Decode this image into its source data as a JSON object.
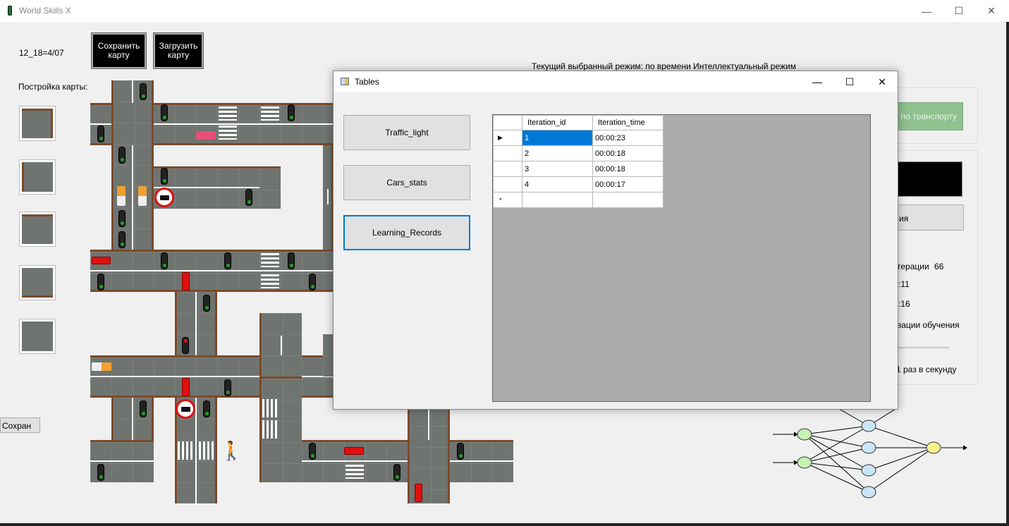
{
  "window": {
    "title": "World Skills X",
    "min": "—",
    "max": "☐",
    "close": "✕"
  },
  "left": {
    "id_label": "12_18=4/07",
    "save_map": "Сохранить карту",
    "load_map": "Загрузить карту",
    "build_label": "Постройка карты:",
    "save_small": "Сохран"
  },
  "mode_text": "Текущий выбранный режим:  по времени Интеллектуальный режим",
  "right_panel": {
    "transport_btn": "м по транспорту",
    "learn_btn_partial": "ия",
    "iterations_label": "терации",
    "iterations_value": "66",
    "time1": ":0:11",
    "time2": ":0:16",
    "viz_label": "вации обучения",
    "speed_label": "1 раз в секунду"
  },
  "dialog": {
    "title": "Tables",
    "buttons": [
      "Traffic_light",
      "Cars_stats",
      "Learning_Records"
    ],
    "grid": {
      "columns": [
        "Iteration_id",
        "Iteration_time"
      ],
      "rows": [
        {
          "id": "1",
          "time": "00:00:23"
        },
        {
          "id": "2",
          "time": "00:00:18"
        },
        {
          "id": "3",
          "time": "00:00:18"
        },
        {
          "id": "4",
          "time": "00:00:17"
        }
      ],
      "current_row_marker": "▶",
      "new_row_marker": "*"
    }
  },
  "colors": {
    "accent": "#0078d7",
    "road": "#6f7470",
    "curb": "#7a4a2a",
    "green_button": "#8fc28f"
  }
}
